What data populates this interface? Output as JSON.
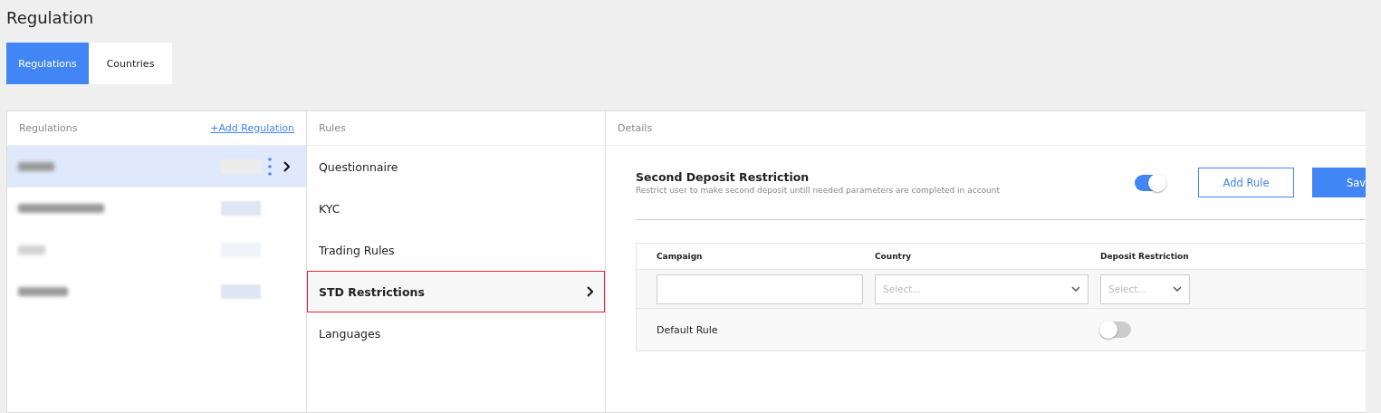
{
  "page_title": "Regulation",
  "tabs": [
    {
      "label": "Regulations",
      "selected": true
    },
    {
      "label": "Countries",
      "selected": false
    }
  ],
  "regulations_panel": {
    "header": "Regulations",
    "add_link": "+Add Regulation",
    "rows": [
      {
        "selected": true,
        "faded": false
      },
      {
        "selected": false,
        "faded": false
      },
      {
        "selected": false,
        "faded": true
      },
      {
        "selected": false,
        "faded": false
      }
    ]
  },
  "rules_panel": {
    "header": "Rules",
    "items": [
      {
        "label": "Questionnaire",
        "selected": false
      },
      {
        "label": "KYC",
        "selected": false
      },
      {
        "label": "Trading Rules",
        "selected": false
      },
      {
        "label": "STD Restrictions",
        "selected": true
      },
      {
        "label": "Languages",
        "selected": false
      }
    ]
  },
  "details_panel": {
    "header": "Details",
    "title": "Second Deposit Restriction",
    "description": "Restrict user to make second deposit untill needed parameters are completed in account",
    "enabled": true,
    "buttons": [
      {
        "label": "Add Rule",
        "kind": "outline"
      },
      {
        "label": "Sav",
        "kind": "primary"
      }
    ],
    "table": {
      "columns": [
        "Campaign",
        "Country",
        "Deposit Restriction"
      ],
      "country": {
        "placeholder": "Select..."
      },
      "deposit_restriction": {
        "placeholder": "Select..."
      },
      "default_rule": {
        "label": "Default Rule",
        "on": false
      }
    }
  }
}
